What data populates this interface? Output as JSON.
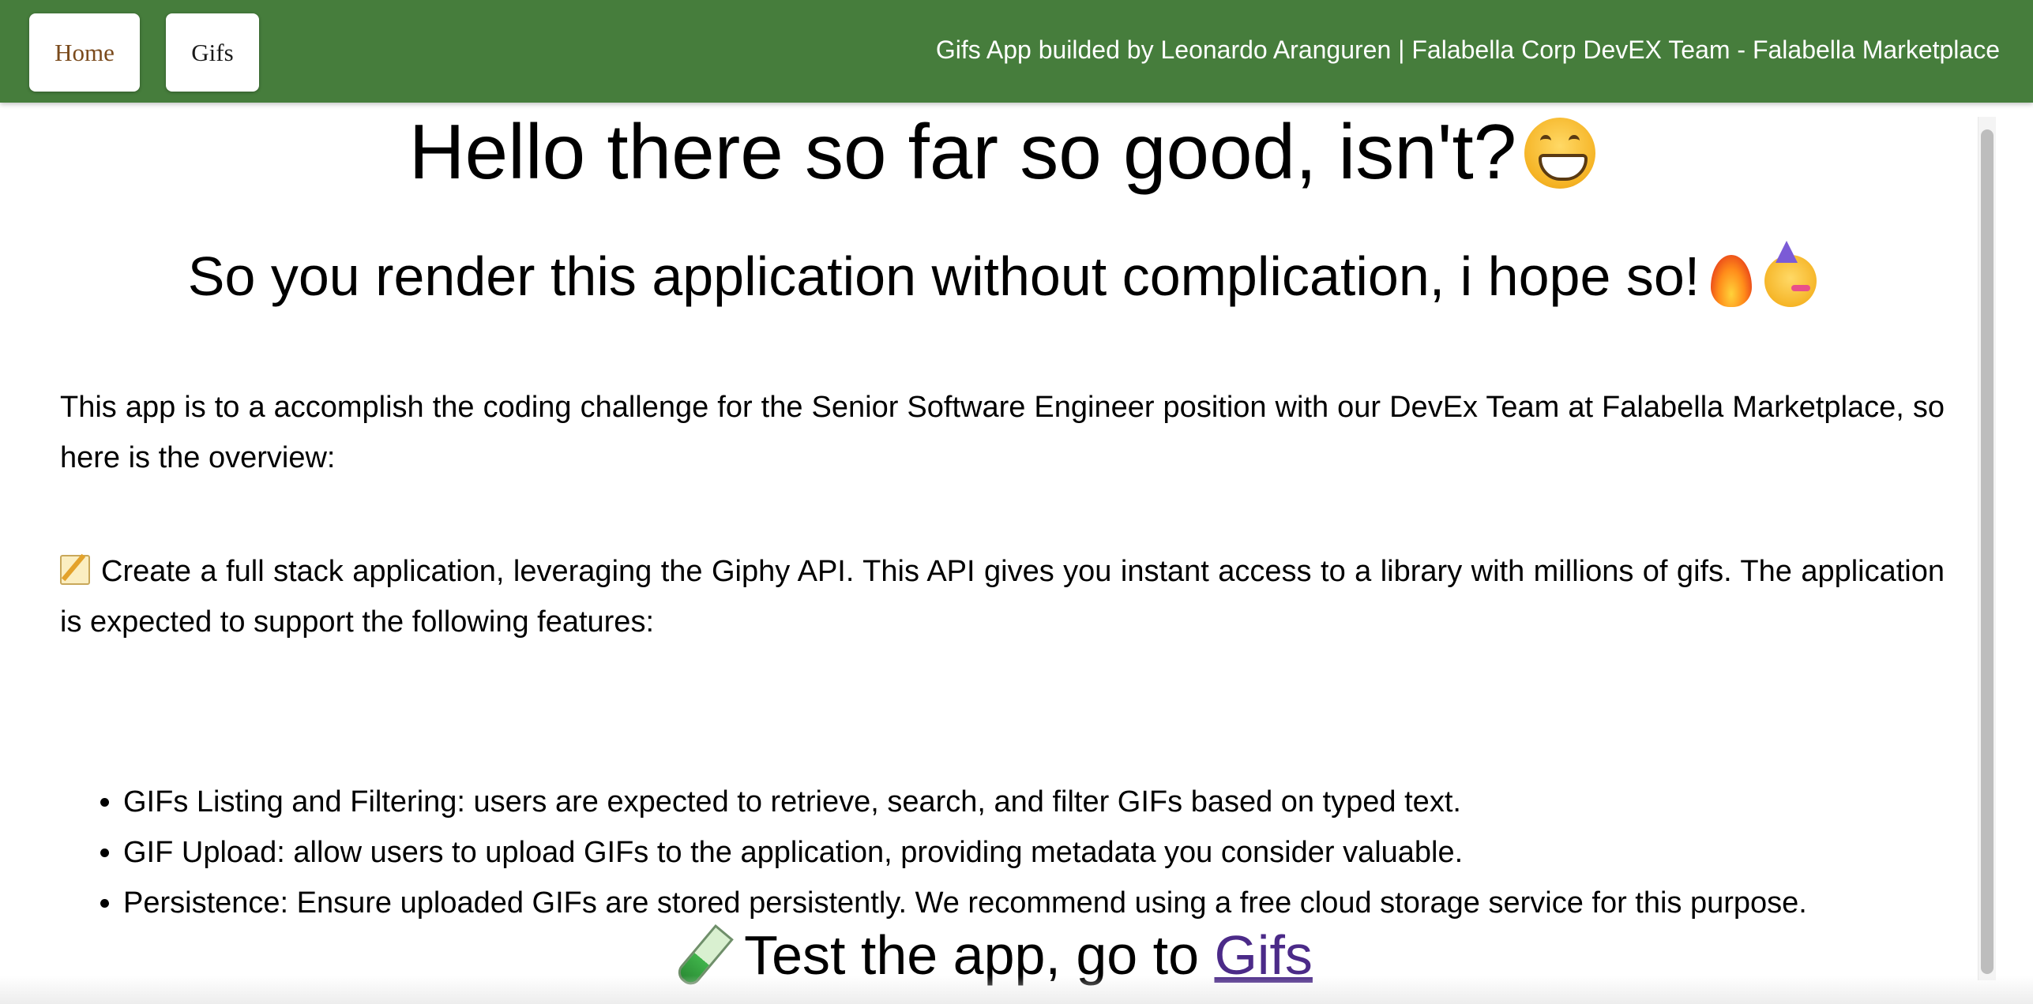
{
  "navbar": {
    "home_label": "Home",
    "gifs_label": "Gifs",
    "credit": "Gifs App builded by Leonardo Aranguren | Falabella Corp DevEX Team - Falabella Marketplace",
    "bg_color": "#467d3c"
  },
  "main": {
    "heading": "Hello there so far so good, isn't?",
    "heading_emoji": "grinning-face-icon",
    "subheading": "So you render this application without complication, i hope so!",
    "subheading_emojis": [
      "fire-icon",
      "partying-face-icon"
    ],
    "overview": "This app is to a accomplish the coding challenge for the Senior Software Engineer position with our DevEx Team at Falabella Marketplace, so here is the overview:",
    "task_emoji": "memo-icon",
    "task": "Create a full stack application, leveraging the Giphy API. This API gives you instant access to a library with millions of gifs. The application is expected to support the following features:",
    "features": [
      "GIFs Listing and Filtering: users are expected to retrieve, search, and filter GIFs based on typed text.",
      "GIF Upload: allow users to upload GIFs to the application, providing metadata you consider valuable.",
      "Persistence: Ensure uploaded GIFs are stored persistently. We recommend using a free cloud storage service for this purpose."
    ],
    "test_emoji": "test-tube-icon",
    "test_prefix": "Test the app, go to",
    "test_link": "Gifs",
    "link_color": "#4b2a88"
  }
}
